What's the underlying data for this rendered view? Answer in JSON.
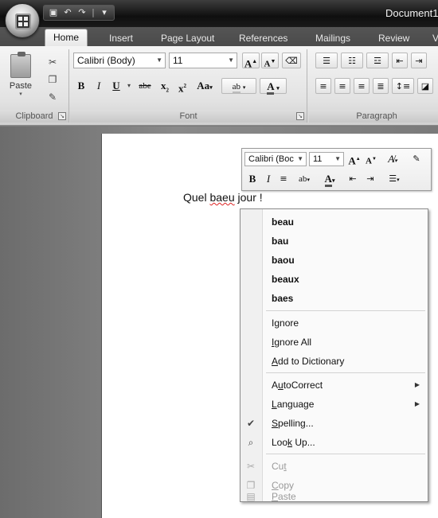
{
  "titlebar": {
    "document_title": "Document1",
    "qat_icons": [
      "save-icon",
      "undo-icon",
      "redo-icon",
      "customize-icon"
    ]
  },
  "tabs": [
    {
      "label": "Home",
      "active": true
    },
    {
      "label": "Insert"
    },
    {
      "label": "Page Layout"
    },
    {
      "label": "References"
    },
    {
      "label": "Mailings"
    },
    {
      "label": "Review"
    },
    {
      "label": "V"
    }
  ],
  "ribbon": {
    "clipboard": {
      "label": "Clipboard",
      "paste_label": "Paste"
    },
    "font": {
      "label": "Font",
      "font_name": "Calibri (Body)",
      "font_size": "11",
      "grow_font": "A",
      "shrink_font": "A",
      "bold": "B",
      "italic": "I",
      "underline": "U",
      "strikethrough": "abe",
      "subscript": "x",
      "superscript": "x",
      "change_case": "Aa",
      "highlight": "ab",
      "font_color": "A"
    },
    "paragraph": {
      "label": "Paragraph"
    }
  },
  "mini_toolbar": {
    "font_name": "Calibri (Boc",
    "font_size": "11",
    "grow": "A",
    "shrink": "A",
    "bold": "B",
    "italic": "I",
    "color": "A"
  },
  "document": {
    "before": "Quel ",
    "misspelled": "baeu",
    "after": " jour !"
  },
  "context_menu": {
    "suggestions": [
      "beau",
      "bau",
      "baou",
      "beaux",
      "baes"
    ],
    "actions": [
      {
        "pre": "I",
        "u": "g",
        "post": "nore"
      },
      {
        "pre": "",
        "u": "I",
        "post": "gnore All"
      },
      {
        "pre": "",
        "u": "A",
        "post": "dd to Dictionary"
      }
    ],
    "submenus": [
      {
        "pre": "A",
        "u": "u",
        "post": "toCorrect"
      },
      {
        "pre": "",
        "u": "L",
        "post": "anguage"
      }
    ],
    "tools": [
      {
        "pre": "",
        "u": "S",
        "post": "pelling...",
        "icon": "spelling-icon"
      },
      {
        "pre": "Loo",
        "u": "k",
        "post": " Up...",
        "icon": "research-icon"
      }
    ],
    "clipboard": [
      {
        "pre": "Cu",
        "u": "t",
        "post": "",
        "icon": "cut-icon"
      },
      {
        "pre": "",
        "u": "C",
        "post": "opy",
        "icon": "copy-icon"
      },
      {
        "pre": "",
        "u": "P",
        "post": "aste",
        "icon": "paste-icon"
      }
    ]
  }
}
